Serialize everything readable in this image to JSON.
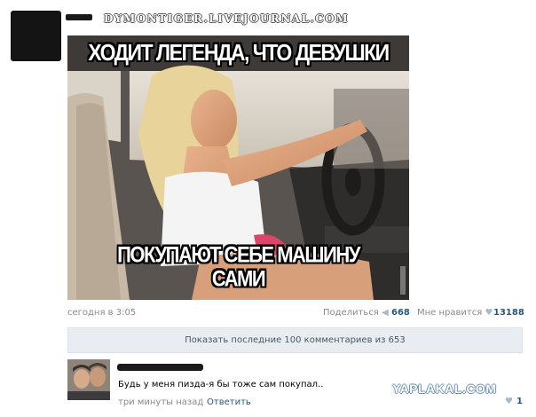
{
  "watermark_top": "DYMONTIGER.LIVEJOURNAL.COM",
  "meme": {
    "caption_top": "ХОДИТ ЛЕГЕНДА, ЧТО ДЕВУШКИ",
    "caption_bottom_line1": "ПОКУПАЮТ СЕБЕ МАШИНУ",
    "caption_bottom_line2": "САМИ"
  },
  "post": {
    "date": "сегодня в 3:05",
    "share_label": "Поделиться",
    "share_count": "668",
    "like_label": "Мне нравится",
    "like_count": "13188"
  },
  "show_more": "Показать последние 100 комментариев из 653",
  "comment": {
    "text": "Будь у меня пизда-я бы тоже сам покупал..",
    "time": "три минуты назад",
    "separator": "|",
    "reply_label": "Ответить",
    "like_count": "1"
  },
  "watermark_bottom": "YAPLAKAL.COM",
  "icons": {
    "share": "megaphone-icon",
    "like": "heart-icon"
  },
  "colors": {
    "link": "#2b587a",
    "meta": "#8a8a8a",
    "bar_bg": "#e9edf2"
  }
}
